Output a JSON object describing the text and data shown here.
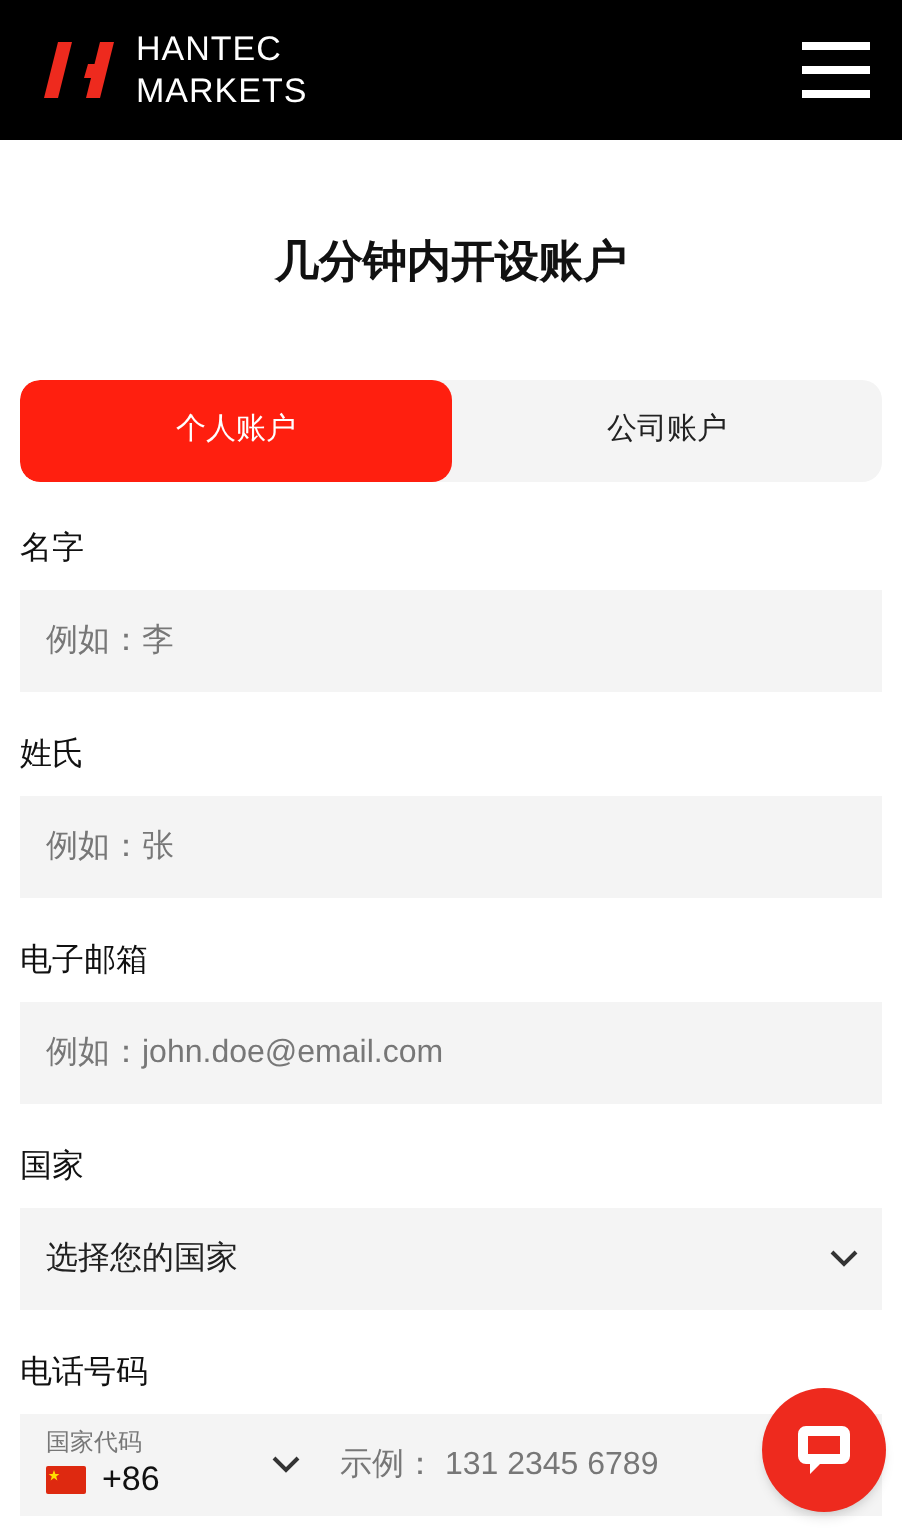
{
  "header": {
    "logo_line_1": "HANTEC",
    "logo_line_2": "MARKETS"
  },
  "title": "几分钟内开设账户",
  "tabs": [
    {
      "label": "个人账户",
      "selected": true
    },
    {
      "label": "公司账户",
      "selected": false
    }
  ],
  "fields": [
    {
      "kind": "text",
      "label": "名字",
      "placeholder": "例如：李"
    },
    {
      "kind": "text",
      "label": "姓氏",
      "placeholder": "例如：张"
    },
    {
      "kind": "text",
      "label": "电子邮箱",
      "placeholder": "例如：john.doe@email.com"
    },
    {
      "kind": "select",
      "label": "国家",
      "value": "选择您的国家"
    },
    {
      "kind": "phone",
      "label": "电话号码",
      "code_label": "国家代码",
      "code": "+86",
      "placeholder": "示例： 131 2345 6789"
    }
  ]
}
